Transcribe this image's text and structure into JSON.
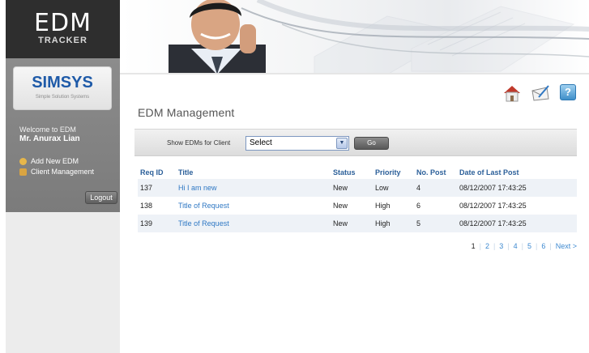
{
  "sidebar": {
    "logo_main": "EDM",
    "logo_sub": "TRACKER",
    "company_logo": "SIMSYS",
    "company_tagline": "Simple Solution Systems",
    "welcome_text": "Welcome to EDM",
    "user_name": "Mr. Anurax Lian",
    "links": [
      {
        "label": "Add New EDM",
        "icon": "user-add-icon"
      },
      {
        "label": "Client Management",
        "icon": "folder-icon"
      }
    ],
    "logout_label": "Logout"
  },
  "toolbar": {
    "home_icon": "home-icon",
    "mail_icon": "mail-icon",
    "help_label": "?"
  },
  "main": {
    "title": "EDM Management",
    "filter": {
      "label": "Show EDMs for Client",
      "select_value": "Select",
      "go_label": "Go"
    },
    "table": {
      "headers": [
        "Req ID",
        "Title",
        "Status",
        "Priority",
        "No. Post",
        "Date of Last Post"
      ],
      "rows": [
        {
          "req_id": "137",
          "title": "Hi I am new",
          "status": "New",
          "priority": "Low",
          "posts": "4",
          "date": "08/12/2007 17:43:25"
        },
        {
          "req_id": "138",
          "title": "Title of Request",
          "status": "New",
          "priority": "High",
          "posts": "6",
          "date": "08/12/2007 17:43:25"
        },
        {
          "req_id": "139",
          "title": "Title of Request",
          "status": "New",
          "priority": "High",
          "posts": "5",
          "date": "08/12/2007 17:43:25"
        }
      ]
    },
    "pagination": {
      "pages": [
        "1",
        "2",
        "3",
        "4",
        "5",
        "6"
      ],
      "next_label": "Next >"
    }
  },
  "colors": {
    "link": "#2f78c4",
    "header_text": "#2b5f99",
    "sidebar_dark": "#2e2e2e",
    "sidebar_grey": "#858585"
  }
}
